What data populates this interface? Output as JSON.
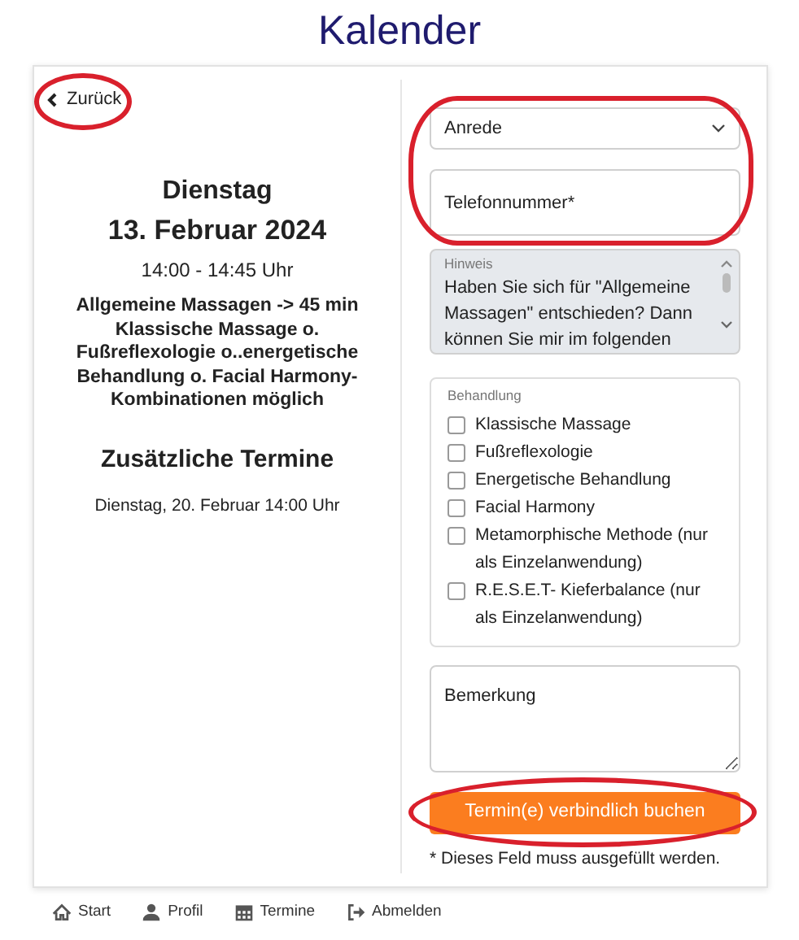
{
  "title": "Kalender",
  "back": {
    "label": "Zurück",
    "circled": true
  },
  "appointment": {
    "day": "Dienstag",
    "date": "13. Februar 2024",
    "time": "14:00 - 14:45 Uhr",
    "description": "Allgemeine Massagen -> 45 min Klassische Massage o. Fußreflexologie o..energetische Behandlung o. Facial Harmony-Kombinationen möglich",
    "extra_heading": "Zusätzliche Termine",
    "extra_dates": [
      "Dienstag, 20. Februar 14:00 Uhr"
    ]
  },
  "form": {
    "contact": {
      "circled": true,
      "salutation": {
        "value": "Anrede"
      },
      "phone": {
        "placeholder": "Telefonnummer*"
      }
    },
    "hint": {
      "label": "Hinweis",
      "text": "Haben Sie sich für \"Allgemeine Massagen\" entschieden? Dann können Sie mir im folgenden"
    },
    "treatment": {
      "legend": "Behandlung",
      "options": [
        {
          "label": "Klassische Massage",
          "checked": false
        },
        {
          "label": "Fußreflexologie",
          "checked": false
        },
        {
          "label": "Energetische Behandlung",
          "checked": false
        },
        {
          "label": "Facial Harmony",
          "checked": false
        },
        {
          "label": "Metamorphische Methode (nur als Einzelanwendung)",
          "checked": false
        },
        {
          "label": "R.E.S.E.T- Kieferbalance (nur als Einzelanwendung)",
          "checked": false
        }
      ]
    },
    "remark": {
      "placeholder": "Bemerkung"
    },
    "submit": {
      "label": "Termin(e) verbindlich buchen",
      "circled": true
    },
    "required_note": "* Dieses Feld muss ausgefüllt werden."
  },
  "nav": [
    {
      "label": "Start",
      "kind": "home"
    },
    {
      "label": "Profil",
      "kind": "user"
    },
    {
      "label": "Termine",
      "kind": "calendar"
    },
    {
      "label": "Abmelden",
      "kind": "logout"
    }
  ]
}
